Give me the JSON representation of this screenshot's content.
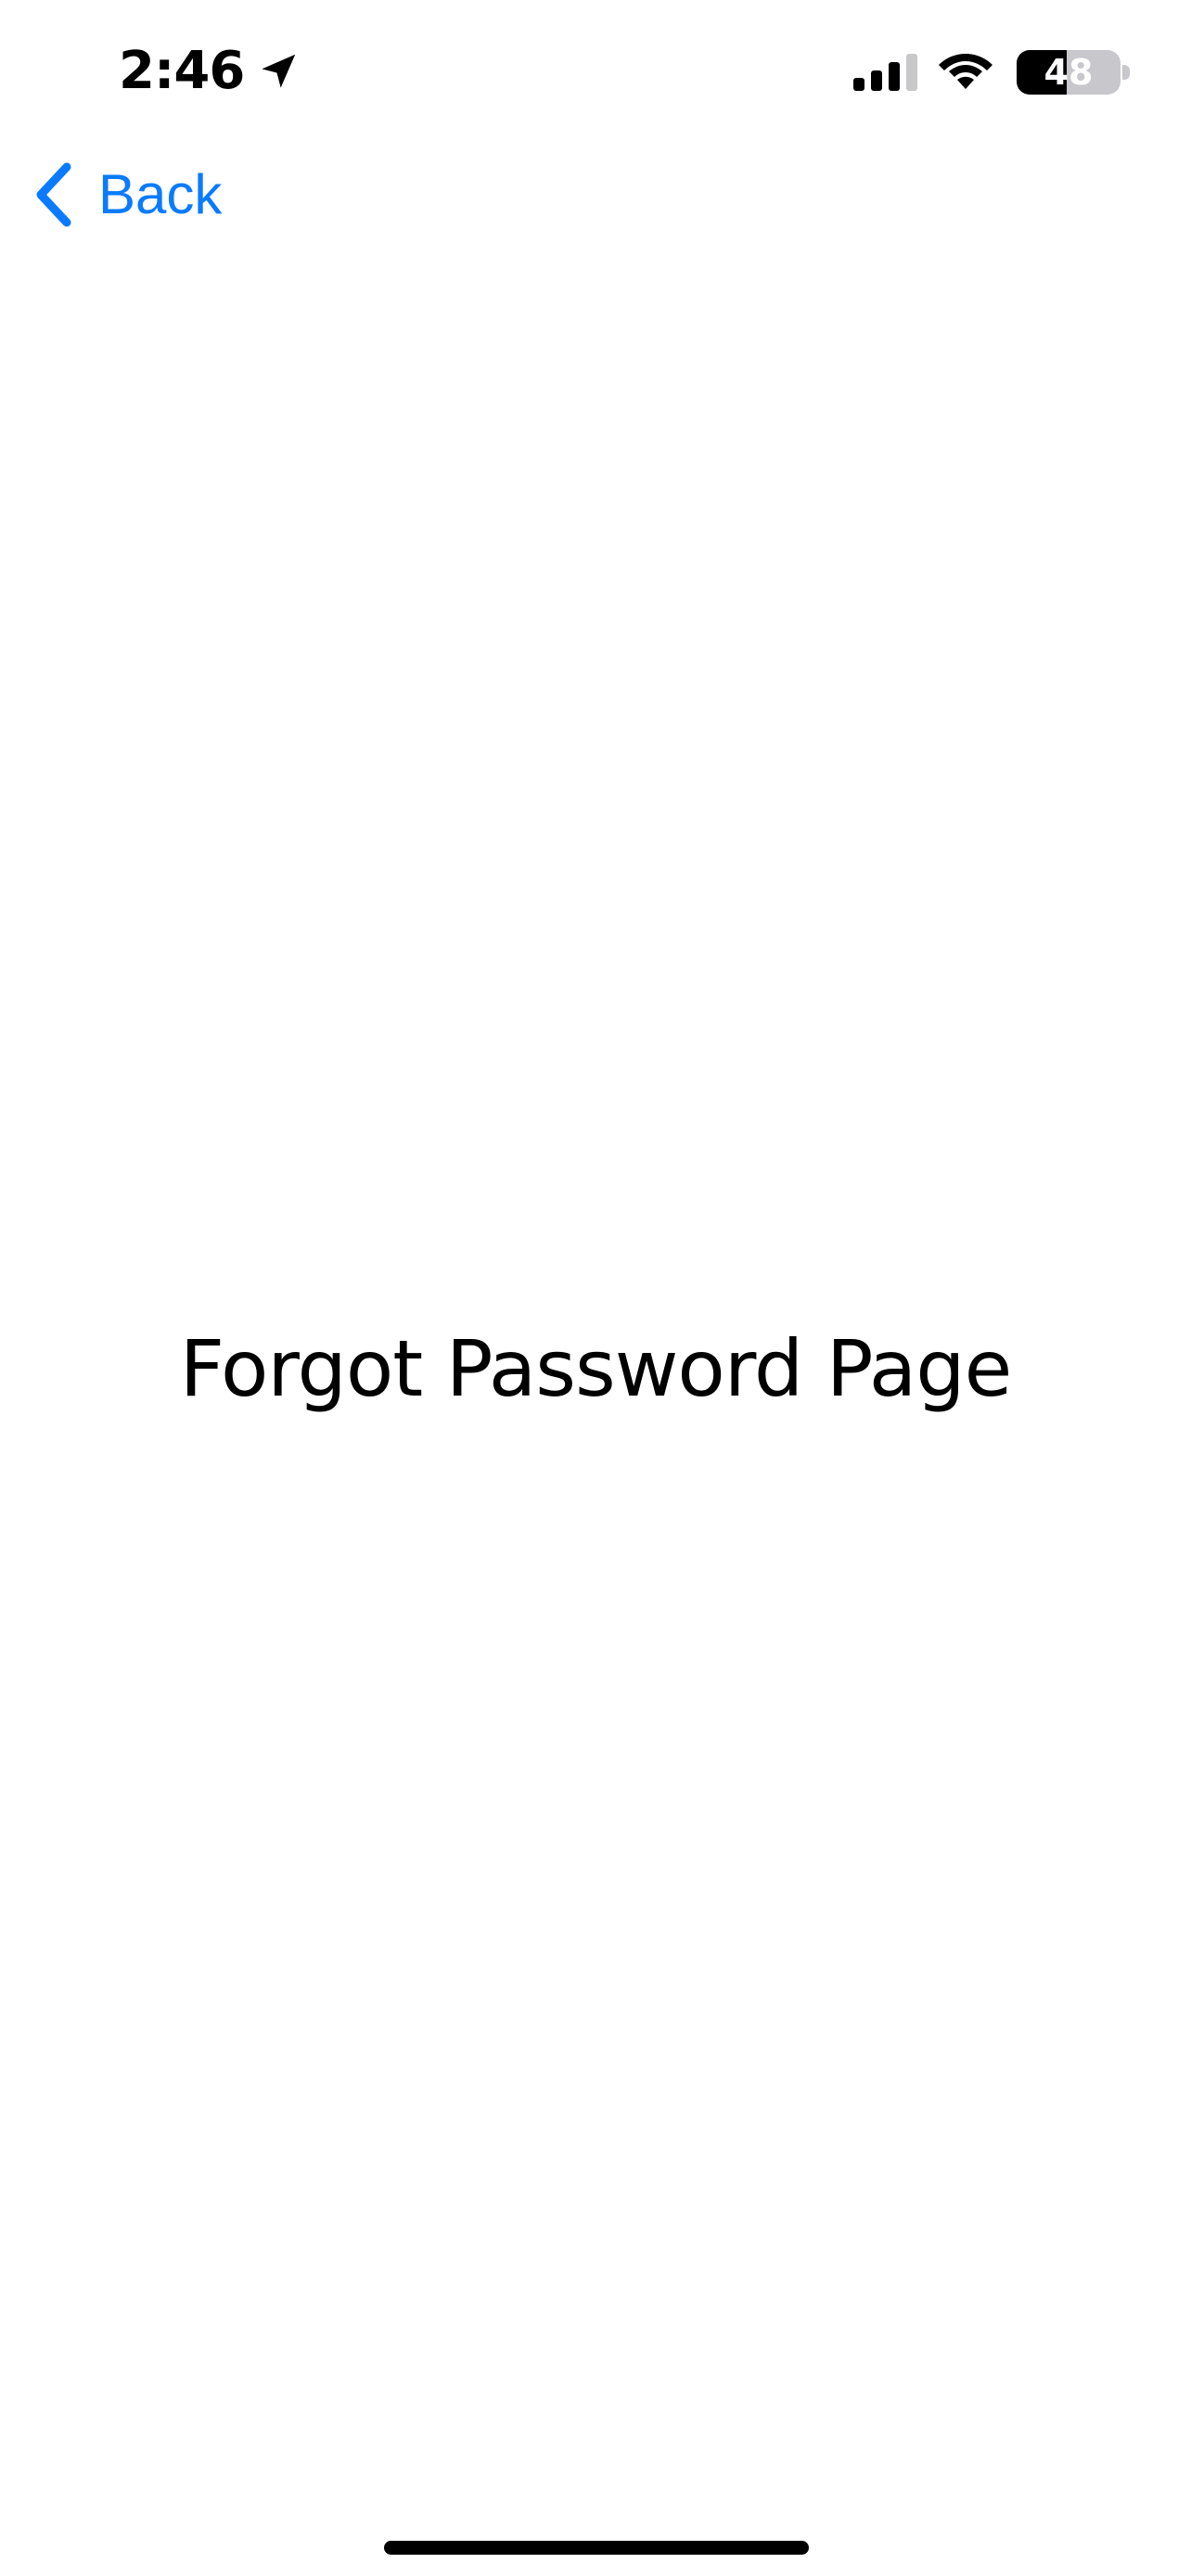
{
  "status_bar": {
    "time": "2:46",
    "location_icon": "location-arrow-icon",
    "signal_icon": "cellular-signal-icon",
    "wifi_icon": "wifi-icon",
    "battery_icon": "battery-icon",
    "battery_level": "48",
    "battery_level_fraction": 0.48
  },
  "nav": {
    "back_label": "Back",
    "back_icon": "chevron-left-icon",
    "accent_color": "#0a7bff"
  },
  "main": {
    "title": "Forgot Password Page"
  }
}
